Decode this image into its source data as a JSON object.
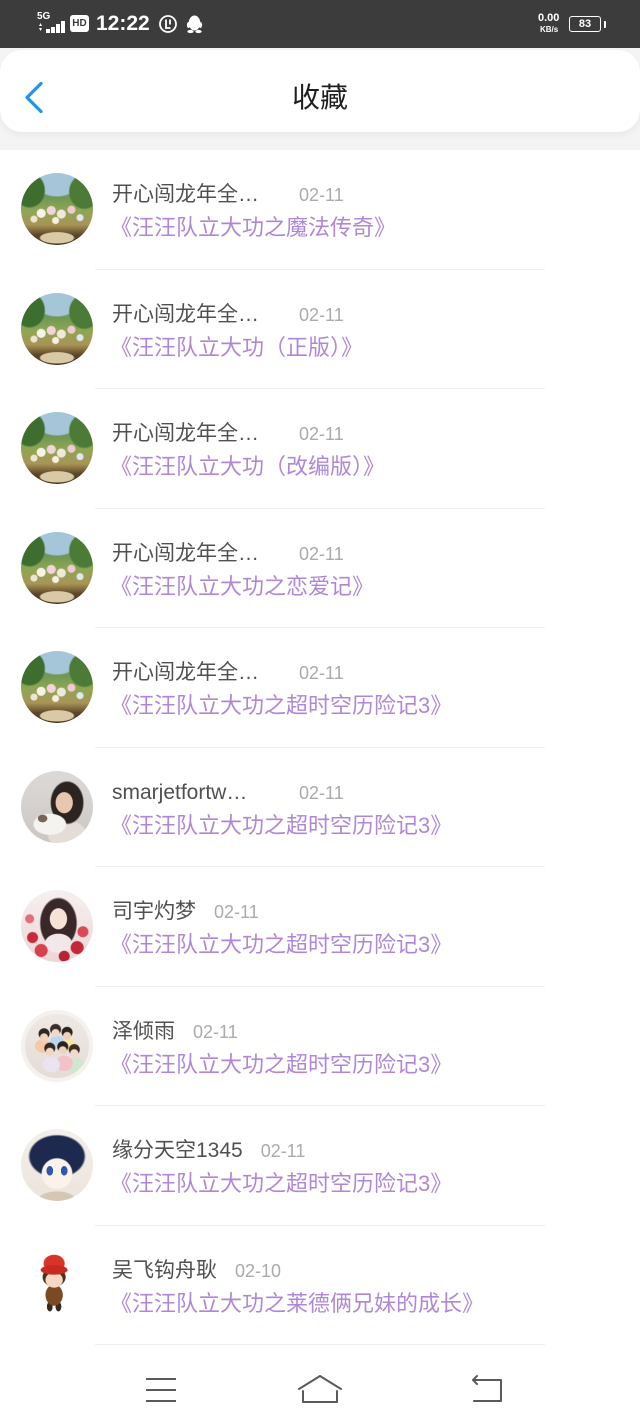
{
  "status_bar": {
    "network": "5G",
    "hd_badge": "HD",
    "time": "12:22",
    "net_speed": "0.00",
    "net_speed_unit": "KB/s",
    "battery_level": "83",
    "icons": [
      "signal-icon",
      "status-circle-icon",
      "qq-icon",
      "battery-icon"
    ]
  },
  "header": {
    "title": "收藏",
    "back_icon": "chevron-left-icon"
  },
  "list": {
    "items": [
      {
        "name": "开心闯龙年全…",
        "date": "02-11",
        "title": "《汪汪队立大功之魔法传奇》"
      },
      {
        "name": "开心闯龙年全…",
        "date": "02-11",
        "title": "《汪汪队立大功（正版）》"
      },
      {
        "name": "开心闯龙年全…",
        "date": "02-11",
        "title": "《汪汪队立大功（改编版）》"
      },
      {
        "name": "开心闯龙年全…",
        "date": "02-11",
        "title": "《汪汪队立大功之恋爱记》"
      },
      {
        "name": "开心闯龙年全…",
        "date": "02-11",
        "title": "《汪汪队立大功之超时空历险记3》"
      },
      {
        "name": "smarjetfortw…",
        "date": "02-11",
        "title": "《汪汪队立大功之超时空历险记3》"
      },
      {
        "name": "司宇灼梦",
        "date": "02-11",
        "title": "《汪汪队立大功之超时空历险记3》"
      },
      {
        "name": "泽倾雨",
        "date": "02-11",
        "title": "《汪汪队立大功之超时空历险记3》"
      },
      {
        "name": "缘分天空1345",
        "date": "02-11",
        "title": "《汪汪队立大功之超时空历险记3》"
      },
      {
        "name": "吴飞钩舟耿",
        "date": "02-10",
        "title": "《汪汪队立大功之莱德俩兄妹的成长》"
      }
    ]
  },
  "nav_bar": {
    "icons": [
      "menu-icon",
      "home-icon",
      "back-icon"
    ]
  },
  "colors": {
    "accent": "#1f94e8",
    "item_title": "#b087d8",
    "status_bar_bg": "#3c3c3c"
  }
}
